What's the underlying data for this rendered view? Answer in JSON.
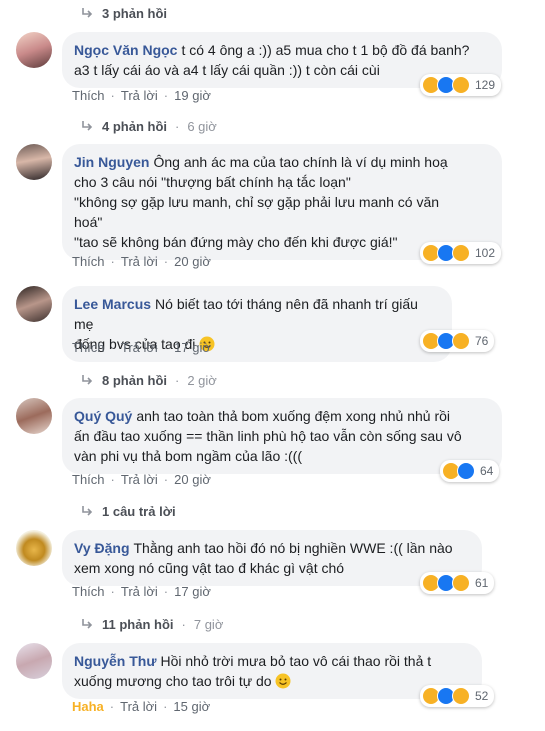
{
  "top_replies": {
    "label": "3 phản hồi"
  },
  "comments": [
    {
      "author": "Ngọc Văn Ngọc",
      "text_lines": [
        "t có 4 ông a :)) a5 mua cho t 1 bộ đồ đá banh?",
        "a3 t lấy cái áo và a4 t lấy cái quần :)) t còn cái cùi"
      ],
      "reaction_count": "129",
      "actions": {
        "like": "Thích",
        "reply": "Trả lời",
        "time": "19 giờ"
      },
      "replies": {
        "label": "4 phản hồi",
        "time": "6 giờ"
      }
    },
    {
      "author": "Jin Nguyen",
      "text_lines": [
        "Ông anh ác ma của tao chính là ví dụ minh hoạ",
        "cho 3 câu nói \"thượng bất chính hạ tắc loạn\"",
        "\"không sợ gặp lưu manh, chỉ sợ gặp phải lưu manh có văn",
        "hoá\"",
        "\"tao sẽ không bán đứng mày cho đến khi được giá!\""
      ],
      "reaction_count": "102",
      "actions": {
        "like": "Thích",
        "reply": "Trả lời",
        "time": "20 giờ"
      }
    },
    {
      "author": "Lee Marcus",
      "text_lines": [
        "Nó biết tao tới tháng nên đã nhanh trí giấu mẹ",
        "đống bvs của tao đi"
      ],
      "reaction_count": "76",
      "actions": {
        "like": "Thích",
        "reply": "Trả lời",
        "time": "17 giờ"
      },
      "replies": {
        "label": "8 phản hồi",
        "time": "2 giờ"
      }
    },
    {
      "author": "Quý Quý",
      "text_lines": [
        "anh tao toàn thả bom xuống đệm xong nhủ nhủ rồi",
        "ấn đầu tao xuống == thần linh phù hộ tao vẫn còn sống sau vô",
        "vàn phi vụ thả bom ngầm của lão :((("
      ],
      "reaction_count": "64",
      "actions": {
        "like": "Thích",
        "reply": "Trả lời",
        "time": "20 giờ"
      },
      "replies": {
        "label": "1 câu trả lời",
        "time": ""
      }
    },
    {
      "author": "Vy Đặng",
      "text_lines": [
        "Thằng anh tao hồi đó nó bị nghiền WWE :(( lần nào",
        "xem xong nó cũng vật tao đ khác gì vật chó"
      ],
      "reaction_count": "61",
      "actions": {
        "like": "Thích",
        "reply": "Trả lời",
        "time": "17 giờ"
      },
      "replies": {
        "label": "11 phản hồi",
        "time": "7 giờ"
      }
    },
    {
      "author": "Nguyễn Thư",
      "text_lines": [
        "Hồi nhỏ trời mưa bỏ tao vô cái thao rồi thả t",
        "xuống mương cho tao trôi tự do"
      ],
      "reaction_count": "52",
      "actions": {
        "like": "Haha",
        "reply": "Trả lời",
        "time": "15 giờ"
      }
    }
  ],
  "colors": {
    "author": "#385898",
    "bubble": "#f2f3f5",
    "haha": "#f7b125",
    "like": "#1877f2"
  },
  "icons": [
    "reply-arrow-icon",
    "haha-reaction-icon",
    "like-reaction-icon",
    "sad-reaction-icon",
    "smile-emoji-icon"
  ]
}
